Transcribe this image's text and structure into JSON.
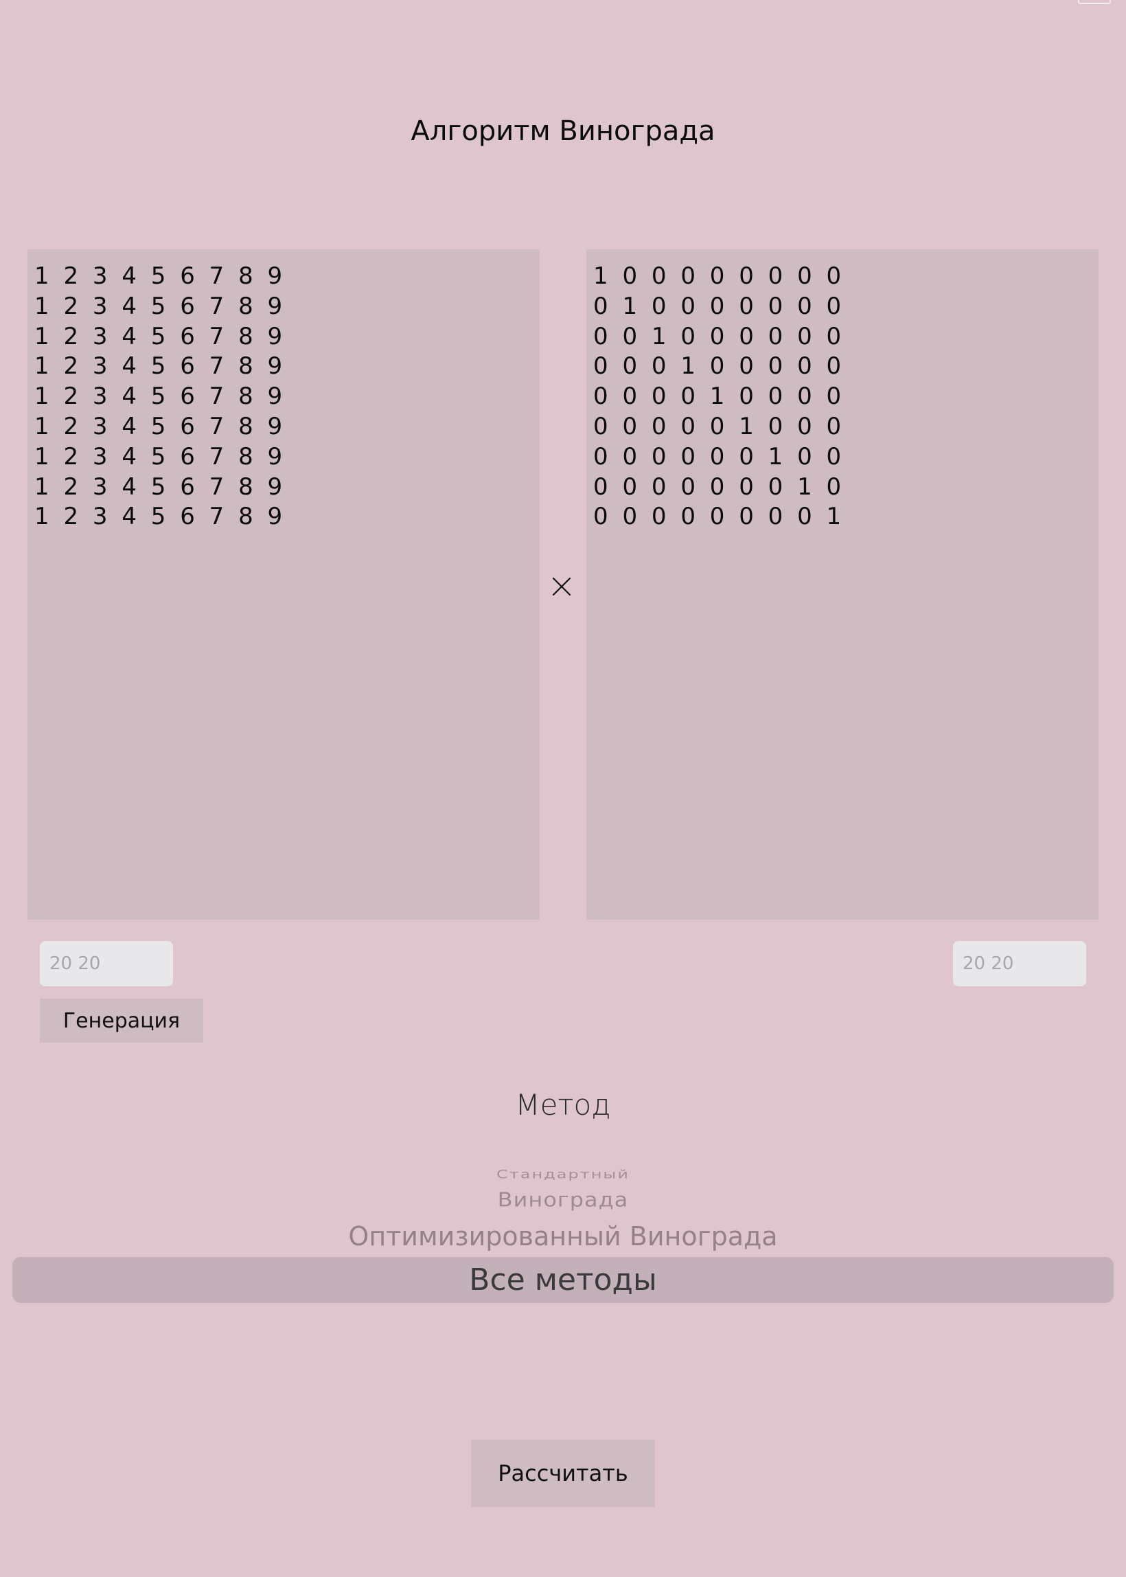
{
  "header": {
    "title": "Алгоритм Винограда"
  },
  "matrices": {
    "left_text": "1 2 3 4 5 6 7 8 9\n1 2 3 4 5 6 7 8 9\n1 2 3 4 5 6 7 8 9\n1 2 3 4 5 6 7 8 9\n1 2 3 4 5 6 7 8 9\n1 2 3 4 5 6 7 8 9\n1 2 3 4 5 6 7 8 9\n1 2 3 4 5 6 7 8 9\n1 2 3 4 5 6 7 8 9",
    "right_text": "1 0 0 0 0 0 0 0 0\n0 1 0 0 0 0 0 0 0\n0 0 1 0 0 0 0 0 0\n0 0 0 1 0 0 0 0 0\n0 0 0 0 1 0 0 0 0\n0 0 0 0 0 1 0 0 0\n0 0 0 0 0 0 1 0 0\n0 0 0 0 0 0 0 1 0\n0 0 0 0 0 0 0 0 1",
    "operator_icon": "multiply-icon"
  },
  "size_inputs": {
    "left": {
      "value": "",
      "placeholder": "20 20"
    },
    "right": {
      "value": "",
      "placeholder": "20 20"
    }
  },
  "buttons": {
    "generate_label": "Генерация",
    "calculate_label": "Рассчитать"
  },
  "method": {
    "label": "Метод",
    "options": [
      "Стандартный",
      "Винограда",
      "Оптимизированный Винограда",
      "Все методы"
    ],
    "selected": "Все методы"
  },
  "colors": {
    "background": "#dfc6ce",
    "panel": "#cfbbc2",
    "input_bg": "#e8e7ea",
    "picker_highlight": "#c4b0b8"
  }
}
